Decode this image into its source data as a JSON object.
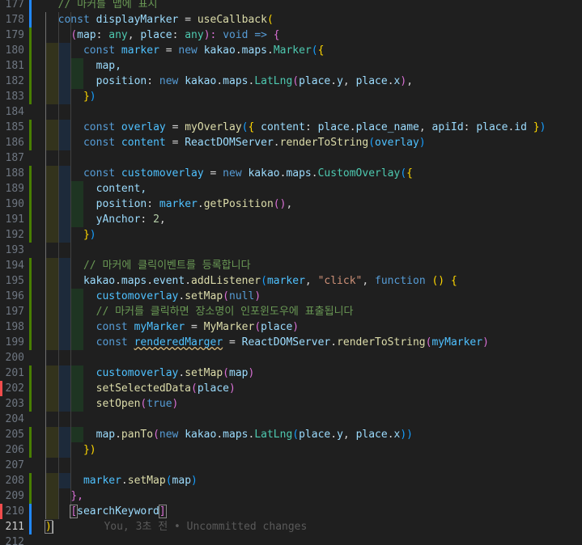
{
  "editor": {
    "current_line": 211,
    "lines": [
      {
        "num": "177",
        "tokens": [
          {
            "t": "  // 마커를 맵에 표시",
            "c": "#6a9955"
          }
        ]
      },
      {
        "num": "178",
        "tokens": [
          {
            "t": "  ",
            "c": "#d4d4d4"
          },
          {
            "t": "const",
            "c": "#569cd6"
          },
          {
            "t": " displayMarker ",
            "c": "#9cdcfe"
          },
          {
            "t": "= ",
            "c": "#d4d4d4"
          },
          {
            "t": "useCallback",
            "c": "#dcdcaa"
          },
          {
            "t": "(",
            "c": "#ffd700"
          }
        ]
      },
      {
        "num": "179",
        "tokens": [
          {
            "t": "    ",
            "c": "#d4d4d4"
          },
          {
            "t": "(",
            "c": "#da70d6"
          },
          {
            "t": "map",
            "c": "#9cdcfe"
          },
          {
            "t": ": ",
            "c": "#d4d4d4"
          },
          {
            "t": "any",
            "c": "#4ec9b0"
          },
          {
            "t": ", ",
            "c": "#d4d4d4"
          },
          {
            "t": "place",
            "c": "#9cdcfe"
          },
          {
            "t": ": ",
            "c": "#d4d4d4"
          },
          {
            "t": "any",
            "c": "#4ec9b0"
          },
          {
            "t": "): ",
            "c": "#da70d6"
          },
          {
            "t": "void",
            "c": "#569cd6"
          },
          {
            "t": " ",
            "c": "#d4d4d4"
          },
          {
            "t": "=>",
            "c": "#569cd6"
          },
          {
            "t": " {",
            "c": "#da70d6"
          }
        ]
      },
      {
        "num": "180",
        "tokens": [
          {
            "t": "      ",
            "c": "#d4d4d4"
          },
          {
            "t": "const",
            "c": "#569cd6"
          },
          {
            "t": " marker ",
            "c": "#4fc1ff"
          },
          {
            "t": "= ",
            "c": "#d4d4d4"
          },
          {
            "t": "new",
            "c": "#569cd6"
          },
          {
            "t": " kakao",
            "c": "#9cdcfe"
          },
          {
            "t": ".",
            "c": "#d4d4d4"
          },
          {
            "t": "maps",
            "c": "#9cdcfe"
          },
          {
            "t": ".",
            "c": "#d4d4d4"
          },
          {
            "t": "Marker",
            "c": "#4ec9b0"
          },
          {
            "t": "(",
            "c": "#179fff"
          },
          {
            "t": "{",
            "c": "#ffd700"
          }
        ]
      },
      {
        "num": "181",
        "tokens": [
          {
            "t": "        map,",
            "c": "#9cdcfe"
          }
        ]
      },
      {
        "num": "182",
        "tokens": [
          {
            "t": "        position",
            "c": "#9cdcfe"
          },
          {
            "t": ": ",
            "c": "#d4d4d4"
          },
          {
            "t": "new",
            "c": "#569cd6"
          },
          {
            "t": " kakao",
            "c": "#9cdcfe"
          },
          {
            "t": ".",
            "c": "#d4d4d4"
          },
          {
            "t": "maps",
            "c": "#9cdcfe"
          },
          {
            "t": ".",
            "c": "#d4d4d4"
          },
          {
            "t": "LatLng",
            "c": "#4ec9b0"
          },
          {
            "t": "(",
            "c": "#da70d6"
          },
          {
            "t": "place",
            "c": "#9cdcfe"
          },
          {
            "t": ".",
            "c": "#d4d4d4"
          },
          {
            "t": "y",
            "c": "#9cdcfe"
          },
          {
            "t": ", ",
            "c": "#d4d4d4"
          },
          {
            "t": "place",
            "c": "#9cdcfe"
          },
          {
            "t": ".",
            "c": "#d4d4d4"
          },
          {
            "t": "x",
            "c": "#9cdcfe"
          },
          {
            "t": ")",
            "c": "#da70d6"
          },
          {
            "t": ",",
            "c": "#d4d4d4"
          }
        ]
      },
      {
        "num": "183",
        "tokens": [
          {
            "t": "      ",
            "c": "#d4d4d4"
          },
          {
            "t": "}",
            "c": "#ffd700"
          },
          {
            "t": ")",
            "c": "#179fff"
          }
        ]
      },
      {
        "num": "184",
        "tokens": []
      },
      {
        "num": "185",
        "tokens": [
          {
            "t": "      ",
            "c": "#d4d4d4"
          },
          {
            "t": "const",
            "c": "#569cd6"
          },
          {
            "t": " overlay ",
            "c": "#4fc1ff"
          },
          {
            "t": "= ",
            "c": "#d4d4d4"
          },
          {
            "t": "myOverlay",
            "c": "#dcdcaa"
          },
          {
            "t": "(",
            "c": "#179fff"
          },
          {
            "t": "{",
            "c": "#ffd700"
          },
          {
            "t": " content",
            "c": "#9cdcfe"
          },
          {
            "t": ": ",
            "c": "#d4d4d4"
          },
          {
            "t": "place",
            "c": "#9cdcfe"
          },
          {
            "t": ".",
            "c": "#d4d4d4"
          },
          {
            "t": "place_name",
            "c": "#9cdcfe"
          },
          {
            "t": ", ",
            "c": "#d4d4d4"
          },
          {
            "t": "apiId",
            "c": "#9cdcfe"
          },
          {
            "t": ": ",
            "c": "#d4d4d4"
          },
          {
            "t": "place",
            "c": "#9cdcfe"
          },
          {
            "t": ".",
            "c": "#d4d4d4"
          },
          {
            "t": "id ",
            "c": "#9cdcfe"
          },
          {
            "t": "}",
            "c": "#ffd700"
          },
          {
            "t": ")",
            "c": "#179fff"
          }
        ]
      },
      {
        "num": "186",
        "tokens": [
          {
            "t": "      ",
            "c": "#d4d4d4"
          },
          {
            "t": "const",
            "c": "#569cd6"
          },
          {
            "t": " content ",
            "c": "#4fc1ff"
          },
          {
            "t": "= ",
            "c": "#d4d4d4"
          },
          {
            "t": "ReactDOMServer",
            "c": "#9cdcfe"
          },
          {
            "t": ".",
            "c": "#d4d4d4"
          },
          {
            "t": "renderToString",
            "c": "#dcdcaa"
          },
          {
            "t": "(",
            "c": "#179fff"
          },
          {
            "t": "overlay",
            "c": "#4fc1ff"
          },
          {
            "t": ")",
            "c": "#179fff"
          }
        ]
      },
      {
        "num": "187",
        "tokens": []
      },
      {
        "num": "188",
        "tokens": [
          {
            "t": "      ",
            "c": "#d4d4d4"
          },
          {
            "t": "const",
            "c": "#569cd6"
          },
          {
            "t": " customoverlay ",
            "c": "#4fc1ff"
          },
          {
            "t": "= ",
            "c": "#d4d4d4"
          },
          {
            "t": "new",
            "c": "#569cd6"
          },
          {
            "t": " kakao",
            "c": "#9cdcfe"
          },
          {
            "t": ".",
            "c": "#d4d4d4"
          },
          {
            "t": "maps",
            "c": "#9cdcfe"
          },
          {
            "t": ".",
            "c": "#d4d4d4"
          },
          {
            "t": "CustomOverlay",
            "c": "#4ec9b0"
          },
          {
            "t": "(",
            "c": "#179fff"
          },
          {
            "t": "{",
            "c": "#ffd700"
          }
        ]
      },
      {
        "num": "189",
        "tokens": [
          {
            "t": "        content,",
            "c": "#9cdcfe"
          }
        ]
      },
      {
        "num": "190",
        "tokens": [
          {
            "t": "        position",
            "c": "#9cdcfe"
          },
          {
            "t": ": ",
            "c": "#d4d4d4"
          },
          {
            "t": "marker",
            "c": "#4fc1ff"
          },
          {
            "t": ".",
            "c": "#d4d4d4"
          },
          {
            "t": "getPosition",
            "c": "#dcdcaa"
          },
          {
            "t": "()",
            "c": "#da70d6"
          },
          {
            "t": ",",
            "c": "#d4d4d4"
          }
        ]
      },
      {
        "num": "191",
        "tokens": [
          {
            "t": "        yAnchor",
            "c": "#9cdcfe"
          },
          {
            "t": ": ",
            "c": "#d4d4d4"
          },
          {
            "t": "2",
            "c": "#b5cea8"
          },
          {
            "t": ",",
            "c": "#d4d4d4"
          }
        ]
      },
      {
        "num": "192",
        "tokens": [
          {
            "t": "      ",
            "c": "#d4d4d4"
          },
          {
            "t": "}",
            "c": "#ffd700"
          },
          {
            "t": ")",
            "c": "#179fff"
          }
        ]
      },
      {
        "num": "193",
        "tokens": []
      },
      {
        "num": "194",
        "tokens": [
          {
            "t": "      // 마커에 클릭이벤트를 등록합니다",
            "c": "#6a9955"
          }
        ]
      },
      {
        "num": "195",
        "tokens": [
          {
            "t": "      kakao",
            "c": "#9cdcfe"
          },
          {
            "t": ".",
            "c": "#d4d4d4"
          },
          {
            "t": "maps",
            "c": "#9cdcfe"
          },
          {
            "t": ".",
            "c": "#d4d4d4"
          },
          {
            "t": "event",
            "c": "#9cdcfe"
          },
          {
            "t": ".",
            "c": "#d4d4d4"
          },
          {
            "t": "addListener",
            "c": "#dcdcaa"
          },
          {
            "t": "(",
            "c": "#179fff"
          },
          {
            "t": "marker",
            "c": "#4fc1ff"
          },
          {
            "t": ", ",
            "c": "#d4d4d4"
          },
          {
            "t": "\"click\"",
            "c": "#ce9178"
          },
          {
            "t": ", ",
            "c": "#d4d4d4"
          },
          {
            "t": "function",
            "c": "#569cd6"
          },
          {
            "t": " ",
            "c": "#d4d4d4"
          },
          {
            "t": "()",
            "c": "#ffd700"
          },
          {
            "t": " ",
            "c": "#d4d4d4"
          },
          {
            "t": "{",
            "c": "#ffd700"
          }
        ]
      },
      {
        "num": "196",
        "tokens": [
          {
            "t": "        customoverlay",
            "c": "#4fc1ff"
          },
          {
            "t": ".",
            "c": "#d4d4d4"
          },
          {
            "t": "setMap",
            "c": "#dcdcaa"
          },
          {
            "t": "(",
            "c": "#da70d6"
          },
          {
            "t": "null",
            "c": "#569cd6"
          },
          {
            "t": ")",
            "c": "#da70d6"
          }
        ]
      },
      {
        "num": "197",
        "tokens": [
          {
            "t": "        // 마커를 클릭하면 장소명이 인포윈도우에 표출됩니다",
            "c": "#6a9955"
          }
        ]
      },
      {
        "num": "198",
        "tokens": [
          {
            "t": "        ",
            "c": "#d4d4d4"
          },
          {
            "t": "const",
            "c": "#569cd6"
          },
          {
            "t": " myMarker ",
            "c": "#4fc1ff"
          },
          {
            "t": "= ",
            "c": "#d4d4d4"
          },
          {
            "t": "MyMarker",
            "c": "#dcdcaa"
          },
          {
            "t": "(",
            "c": "#da70d6"
          },
          {
            "t": "place",
            "c": "#9cdcfe"
          },
          {
            "t": ")",
            "c": "#da70d6"
          }
        ]
      },
      {
        "num": "199",
        "tokens": [
          {
            "t": "        ",
            "c": "#d4d4d4"
          },
          {
            "t": "const",
            "c": "#569cd6"
          },
          {
            "t": " ",
            "c": "#d4d4d4"
          },
          {
            "t": "renderedMarger",
            "c": "#4fc1ff",
            "squig": true
          },
          {
            "t": " = ",
            "c": "#d4d4d4"
          },
          {
            "t": "ReactDOMServer",
            "c": "#9cdcfe"
          },
          {
            "t": ".",
            "c": "#d4d4d4"
          },
          {
            "t": "renderToString",
            "c": "#dcdcaa"
          },
          {
            "t": "(",
            "c": "#da70d6"
          },
          {
            "t": "myMarker",
            "c": "#4fc1ff"
          },
          {
            "t": ")",
            "c": "#da70d6"
          }
        ]
      },
      {
        "num": "200",
        "tokens": []
      },
      {
        "num": "201",
        "tokens": [
          {
            "t": "        customoverlay",
            "c": "#4fc1ff"
          },
          {
            "t": ".",
            "c": "#d4d4d4"
          },
          {
            "t": "setMap",
            "c": "#dcdcaa"
          },
          {
            "t": "(",
            "c": "#da70d6"
          },
          {
            "t": "map",
            "c": "#9cdcfe"
          },
          {
            "t": ")",
            "c": "#da70d6"
          }
        ]
      },
      {
        "num": "202",
        "tokens": [
          {
            "t": "        setSelectedData",
            "c": "#dcdcaa"
          },
          {
            "t": "(",
            "c": "#da70d6"
          },
          {
            "t": "place",
            "c": "#9cdcfe"
          },
          {
            "t": ")",
            "c": "#da70d6"
          }
        ]
      },
      {
        "num": "203",
        "tokens": [
          {
            "t": "        setOpen",
            "c": "#dcdcaa"
          },
          {
            "t": "(",
            "c": "#da70d6"
          },
          {
            "t": "true",
            "c": "#569cd6"
          },
          {
            "t": ")",
            "c": "#da70d6"
          }
        ]
      },
      {
        "num": "204",
        "tokens": []
      },
      {
        "num": "205",
        "tokens": [
          {
            "t": "        map",
            "c": "#9cdcfe"
          },
          {
            "t": ".",
            "c": "#d4d4d4"
          },
          {
            "t": "panTo",
            "c": "#dcdcaa"
          },
          {
            "t": "(",
            "c": "#da70d6"
          },
          {
            "t": "new",
            "c": "#569cd6"
          },
          {
            "t": " kakao",
            "c": "#9cdcfe"
          },
          {
            "t": ".",
            "c": "#d4d4d4"
          },
          {
            "t": "maps",
            "c": "#9cdcfe"
          },
          {
            "t": ".",
            "c": "#d4d4d4"
          },
          {
            "t": "LatLng",
            "c": "#4ec9b0"
          },
          {
            "t": "(",
            "c": "#179fff"
          },
          {
            "t": "place",
            "c": "#9cdcfe"
          },
          {
            "t": ".",
            "c": "#d4d4d4"
          },
          {
            "t": "y",
            "c": "#9cdcfe"
          },
          {
            "t": ", ",
            "c": "#d4d4d4"
          },
          {
            "t": "place",
            "c": "#9cdcfe"
          },
          {
            "t": ".",
            "c": "#d4d4d4"
          },
          {
            "t": "x",
            "c": "#9cdcfe"
          },
          {
            "t": "))",
            "c": "#179fff"
          }
        ]
      },
      {
        "num": "206",
        "tokens": [
          {
            "t": "      ",
            "c": "#d4d4d4"
          },
          {
            "t": "})",
            "c": "#ffd700"
          }
        ]
      },
      {
        "num": "207",
        "tokens": []
      },
      {
        "num": "208",
        "tokens": [
          {
            "t": "      marker",
            "c": "#4fc1ff"
          },
          {
            "t": ".",
            "c": "#d4d4d4"
          },
          {
            "t": "setMap",
            "c": "#dcdcaa"
          },
          {
            "t": "(",
            "c": "#179fff"
          },
          {
            "t": "map",
            "c": "#9cdcfe"
          },
          {
            "t": ")",
            "c": "#179fff"
          }
        ]
      },
      {
        "num": "209",
        "tokens": [
          {
            "t": "    ",
            "c": "#d4d4d4"
          },
          {
            "t": "},",
            "c": "#da70d6"
          }
        ]
      },
      {
        "num": "210",
        "tokens": [
          {
            "t": "    ",
            "c": "#d4d4d4"
          },
          {
            "t": "[",
            "c": "#da70d6",
            "box": true
          },
          {
            "t": "searchKeyword",
            "c": "#9cdcfe"
          },
          {
            "t": "]",
            "c": "#da70d6",
            "box": true
          }
        ]
      },
      {
        "num": "211",
        "tokens": [
          {
            "t": ")",
            "c": "#ffd700",
            "box": true
          },
          {
            "t": "        You, 3초 전 • Uncommitted changes",
            "c": "#5a5a5a"
          }
        ]
      },
      {
        "num": "212",
        "tokens": []
      }
    ]
  }
}
